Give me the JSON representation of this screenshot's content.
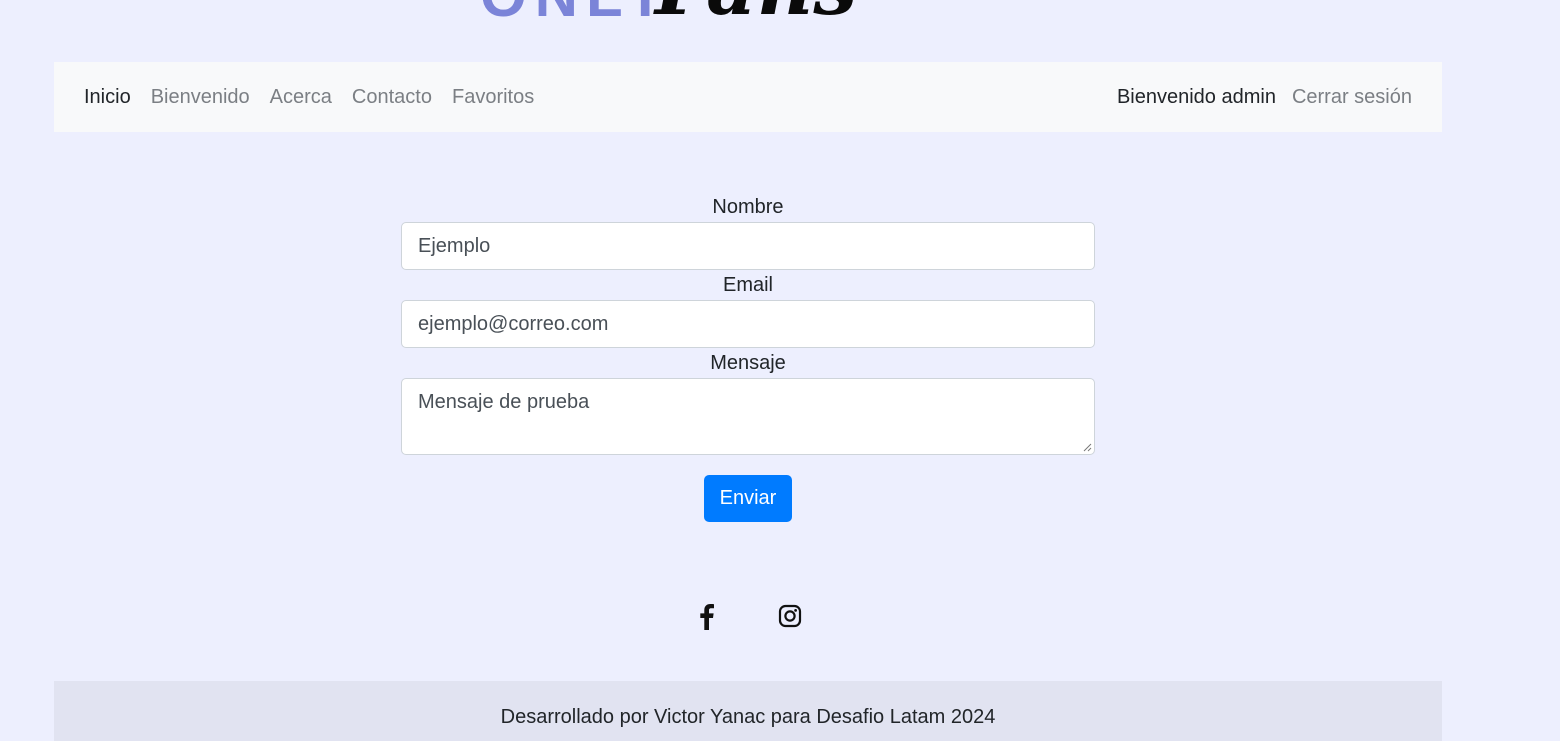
{
  "logo": {
    "text_left": "ONLY",
    "text_right": "Fans",
    "accent_color": "#7b84d8"
  },
  "navbar": {
    "links": [
      {
        "label": "Inicio",
        "active": true
      },
      {
        "label": "Bienvenido",
        "active": false
      },
      {
        "label": "Acerca",
        "active": false
      },
      {
        "label": "Contacto",
        "active": false
      },
      {
        "label": "Favoritos",
        "active": false
      }
    ],
    "welcome_text": "Bienvenido admin",
    "logout_label": "Cerrar sesión"
  },
  "form": {
    "name": {
      "label": "Nombre",
      "value": "Ejemplo"
    },
    "email": {
      "label": "Email",
      "value": "ejemplo@correo.com"
    },
    "message": {
      "label": "Mensaje",
      "value": "Mensaje de prueba"
    },
    "submit_label": "Enviar",
    "submit_color": "#007bff"
  },
  "social": {
    "icons": [
      "facebook-icon",
      "instagram-icon"
    ]
  },
  "footer": {
    "text": "Desarrollado por Victor Yanac para Desafio Latam 2024"
  },
  "colors": {
    "page_background": "#edeffe",
    "navbar_background": "#f8f9fa",
    "footer_background": "#e1e3f1"
  }
}
